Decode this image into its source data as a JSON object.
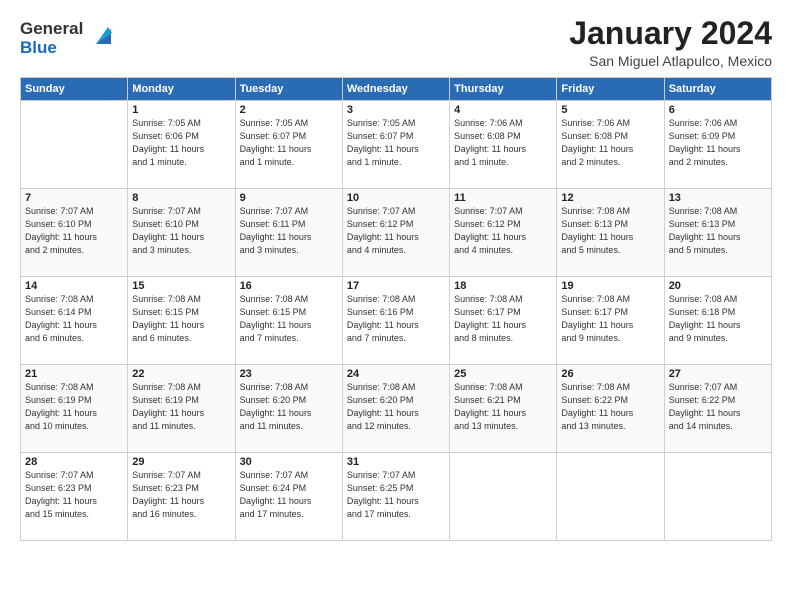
{
  "logo": {
    "line1": "General",
    "line2": "Blue"
  },
  "title": "January 2024",
  "location": "San Miguel Atlapulco, Mexico",
  "days_header": [
    "Sunday",
    "Monday",
    "Tuesday",
    "Wednesday",
    "Thursday",
    "Friday",
    "Saturday"
  ],
  "weeks": [
    [
      {
        "num": "",
        "info": ""
      },
      {
        "num": "1",
        "info": "Sunrise: 7:05 AM\nSunset: 6:06 PM\nDaylight: 11 hours\nand 1 minute."
      },
      {
        "num": "2",
        "info": "Sunrise: 7:05 AM\nSunset: 6:07 PM\nDaylight: 11 hours\nand 1 minute."
      },
      {
        "num": "3",
        "info": "Sunrise: 7:05 AM\nSunset: 6:07 PM\nDaylight: 11 hours\nand 1 minute."
      },
      {
        "num": "4",
        "info": "Sunrise: 7:06 AM\nSunset: 6:08 PM\nDaylight: 11 hours\nand 1 minute."
      },
      {
        "num": "5",
        "info": "Sunrise: 7:06 AM\nSunset: 6:08 PM\nDaylight: 11 hours\nand 2 minutes."
      },
      {
        "num": "6",
        "info": "Sunrise: 7:06 AM\nSunset: 6:09 PM\nDaylight: 11 hours\nand 2 minutes."
      }
    ],
    [
      {
        "num": "7",
        "info": "Sunrise: 7:07 AM\nSunset: 6:10 PM\nDaylight: 11 hours\nand 2 minutes."
      },
      {
        "num": "8",
        "info": "Sunrise: 7:07 AM\nSunset: 6:10 PM\nDaylight: 11 hours\nand 3 minutes."
      },
      {
        "num": "9",
        "info": "Sunrise: 7:07 AM\nSunset: 6:11 PM\nDaylight: 11 hours\nand 3 minutes."
      },
      {
        "num": "10",
        "info": "Sunrise: 7:07 AM\nSunset: 6:12 PM\nDaylight: 11 hours\nand 4 minutes."
      },
      {
        "num": "11",
        "info": "Sunrise: 7:07 AM\nSunset: 6:12 PM\nDaylight: 11 hours\nand 4 minutes."
      },
      {
        "num": "12",
        "info": "Sunrise: 7:08 AM\nSunset: 6:13 PM\nDaylight: 11 hours\nand 5 minutes."
      },
      {
        "num": "13",
        "info": "Sunrise: 7:08 AM\nSunset: 6:13 PM\nDaylight: 11 hours\nand 5 minutes."
      }
    ],
    [
      {
        "num": "14",
        "info": "Sunrise: 7:08 AM\nSunset: 6:14 PM\nDaylight: 11 hours\nand 6 minutes."
      },
      {
        "num": "15",
        "info": "Sunrise: 7:08 AM\nSunset: 6:15 PM\nDaylight: 11 hours\nand 6 minutes."
      },
      {
        "num": "16",
        "info": "Sunrise: 7:08 AM\nSunset: 6:15 PM\nDaylight: 11 hours\nand 7 minutes."
      },
      {
        "num": "17",
        "info": "Sunrise: 7:08 AM\nSunset: 6:16 PM\nDaylight: 11 hours\nand 7 minutes."
      },
      {
        "num": "18",
        "info": "Sunrise: 7:08 AM\nSunset: 6:17 PM\nDaylight: 11 hours\nand 8 minutes."
      },
      {
        "num": "19",
        "info": "Sunrise: 7:08 AM\nSunset: 6:17 PM\nDaylight: 11 hours\nand 9 minutes."
      },
      {
        "num": "20",
        "info": "Sunrise: 7:08 AM\nSunset: 6:18 PM\nDaylight: 11 hours\nand 9 minutes."
      }
    ],
    [
      {
        "num": "21",
        "info": "Sunrise: 7:08 AM\nSunset: 6:19 PM\nDaylight: 11 hours\nand 10 minutes."
      },
      {
        "num": "22",
        "info": "Sunrise: 7:08 AM\nSunset: 6:19 PM\nDaylight: 11 hours\nand 11 minutes."
      },
      {
        "num": "23",
        "info": "Sunrise: 7:08 AM\nSunset: 6:20 PM\nDaylight: 11 hours\nand 11 minutes."
      },
      {
        "num": "24",
        "info": "Sunrise: 7:08 AM\nSunset: 6:20 PM\nDaylight: 11 hours\nand 12 minutes."
      },
      {
        "num": "25",
        "info": "Sunrise: 7:08 AM\nSunset: 6:21 PM\nDaylight: 11 hours\nand 13 minutes."
      },
      {
        "num": "26",
        "info": "Sunrise: 7:08 AM\nSunset: 6:22 PM\nDaylight: 11 hours\nand 13 minutes."
      },
      {
        "num": "27",
        "info": "Sunrise: 7:07 AM\nSunset: 6:22 PM\nDaylight: 11 hours\nand 14 minutes."
      }
    ],
    [
      {
        "num": "28",
        "info": "Sunrise: 7:07 AM\nSunset: 6:23 PM\nDaylight: 11 hours\nand 15 minutes."
      },
      {
        "num": "29",
        "info": "Sunrise: 7:07 AM\nSunset: 6:23 PM\nDaylight: 11 hours\nand 16 minutes."
      },
      {
        "num": "30",
        "info": "Sunrise: 7:07 AM\nSunset: 6:24 PM\nDaylight: 11 hours\nand 17 minutes."
      },
      {
        "num": "31",
        "info": "Sunrise: 7:07 AM\nSunset: 6:25 PM\nDaylight: 11 hours\nand 17 minutes."
      },
      {
        "num": "",
        "info": ""
      },
      {
        "num": "",
        "info": ""
      },
      {
        "num": "",
        "info": ""
      }
    ]
  ]
}
